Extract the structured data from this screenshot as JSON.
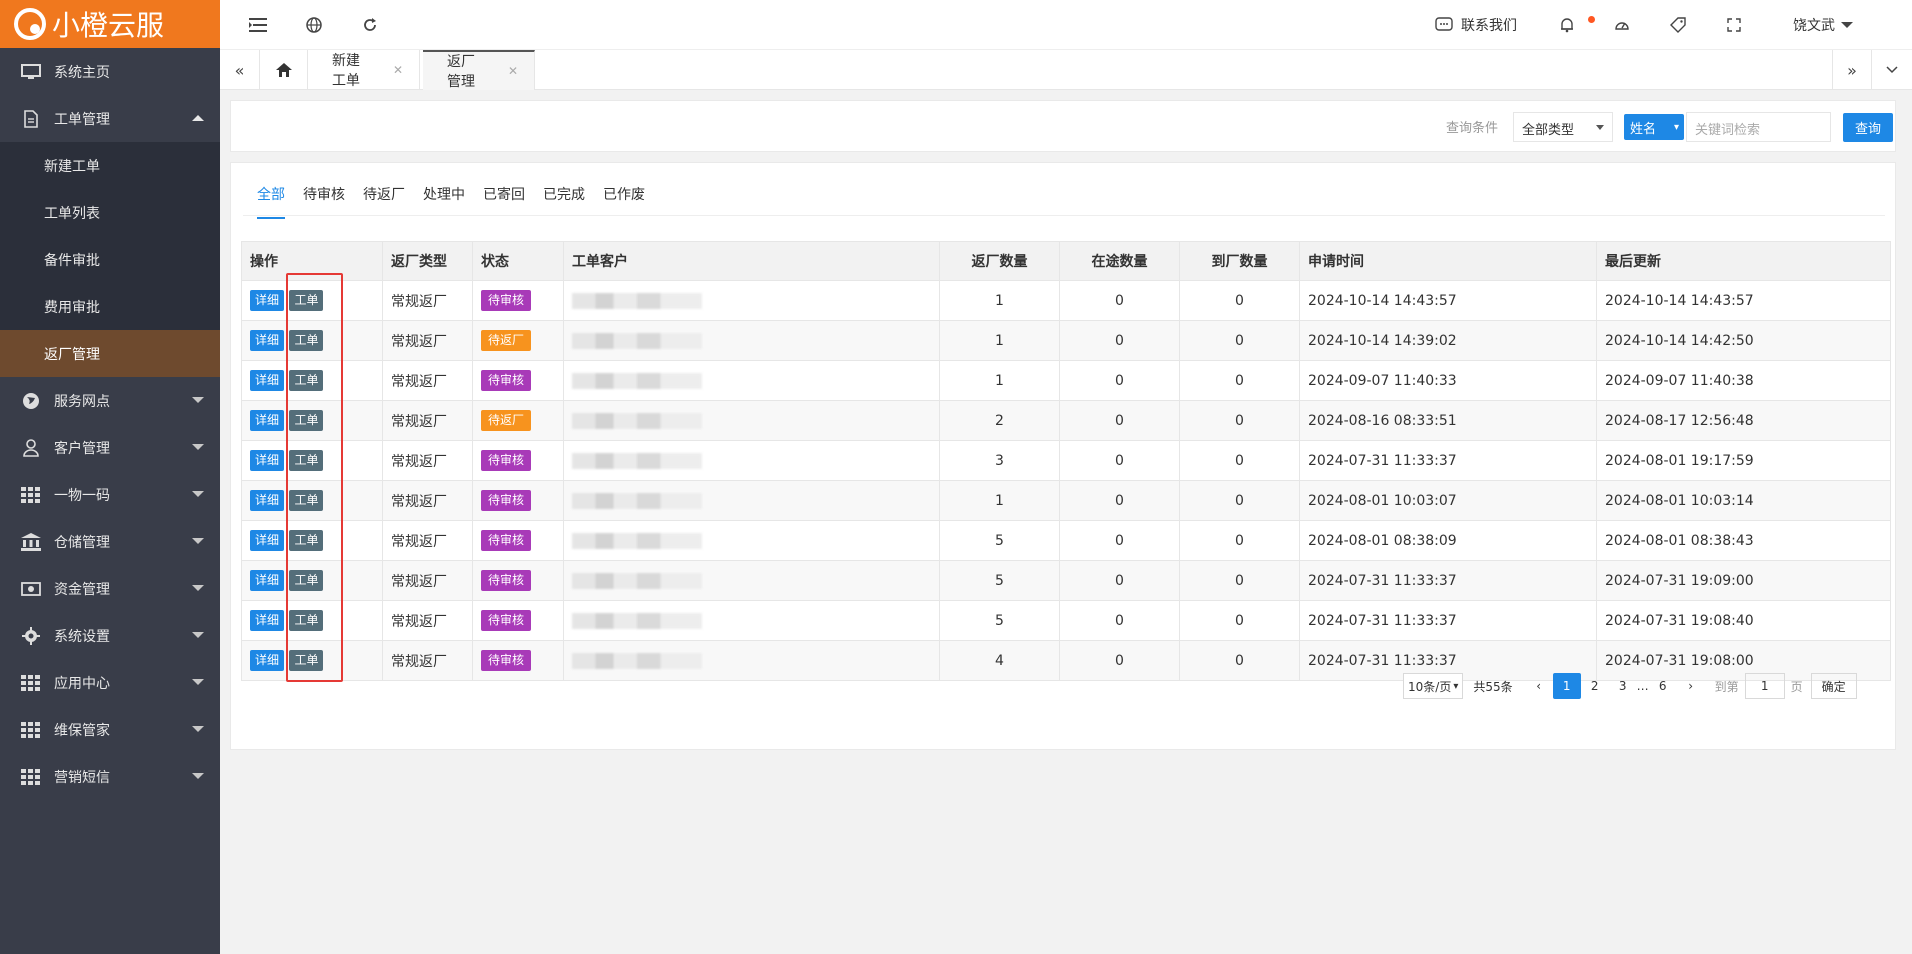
{
  "brand": {
    "name": "小橙云服"
  },
  "sidebar": {
    "items": [
      {
        "label": "系统主页",
        "icon": "monitor-icon"
      },
      {
        "label": "工单管理",
        "icon": "document-icon",
        "expanded": true,
        "children": [
          "新建工单",
          "工单列表",
          "备件审批",
          "费用审批",
          "返厂管理"
        ]
      },
      {
        "label": "服务网点",
        "icon": "globe-icon"
      },
      {
        "label": "客户管理",
        "icon": "user-icon"
      },
      {
        "label": "一物一码",
        "icon": "grid-icon"
      },
      {
        "label": "仓储管理",
        "icon": "bank-icon"
      },
      {
        "label": "资金管理",
        "icon": "money-icon"
      },
      {
        "label": "系统设置",
        "icon": "gear-icon"
      },
      {
        "label": "应用中心",
        "icon": "grid-icon"
      },
      {
        "label": "维保管家",
        "icon": "grid-icon"
      },
      {
        "label": "营销短信",
        "icon": "grid-icon"
      }
    ],
    "active_child": "返厂管理"
  },
  "topbar": {
    "contact_label": "联系我们",
    "user_name": "饶文武"
  },
  "tabs": {
    "items": [
      "新建工单",
      "返厂管理"
    ],
    "active": "返厂管理"
  },
  "search": {
    "condition_label": "查询条件",
    "type_select": "全部类型",
    "field_select": "姓名",
    "keyword_placeholder": "关键词检索",
    "query_button": "查询"
  },
  "filter_tabs": {
    "items": [
      "全部",
      "待审核",
      "待返厂",
      "处理中",
      "已寄回",
      "已完成",
      "已作废"
    ],
    "active": "全部"
  },
  "table": {
    "columns": [
      "操作",
      "返厂类型",
      "状态",
      "工单客户",
      "返厂数量",
      "在途数量",
      "到厂数量",
      "申请时间",
      "最后更新"
    ],
    "action_labels": {
      "detail": "详细",
      "work": "工单"
    },
    "status_colors": {
      "待审核": "#a83ab8",
      "待返厂": "#f7931e"
    },
    "rows": [
      {
        "type": "常规返厂",
        "status": "待审核",
        "qty": "1",
        "transit": "0",
        "arrived": "0",
        "applied": "2024-10-14 14:43:57",
        "updated": "2024-10-14 14:43:57"
      },
      {
        "type": "常规返厂",
        "status": "待返厂",
        "qty": "1",
        "transit": "0",
        "arrived": "0",
        "applied": "2024-10-14 14:39:02",
        "updated": "2024-10-14 14:42:50"
      },
      {
        "type": "常规返厂",
        "status": "待审核",
        "qty": "1",
        "transit": "0",
        "arrived": "0",
        "applied": "2024-09-07 11:40:33",
        "updated": "2024-09-07 11:40:38"
      },
      {
        "type": "常规返厂",
        "status": "待返厂",
        "qty": "2",
        "transit": "0",
        "arrived": "0",
        "applied": "2024-08-16 08:33:51",
        "updated": "2024-08-17 12:56:48"
      },
      {
        "type": "常规返厂",
        "status": "待审核",
        "qty": "3",
        "transit": "0",
        "arrived": "0",
        "applied": "2024-07-31 11:33:37",
        "updated": "2024-08-01 19:17:59"
      },
      {
        "type": "常规返厂",
        "status": "待审核",
        "qty": "1",
        "transit": "0",
        "arrived": "0",
        "applied": "2024-08-01 10:03:07",
        "updated": "2024-08-01 10:03:14"
      },
      {
        "type": "常规返厂",
        "status": "待审核",
        "qty": "5",
        "transit": "0",
        "arrived": "0",
        "applied": "2024-08-01 08:38:09",
        "updated": "2024-08-01 08:38:43"
      },
      {
        "type": "常规返厂",
        "status": "待审核",
        "qty": "5",
        "transit": "0",
        "arrived": "0",
        "applied": "2024-07-31 11:33:37",
        "updated": "2024-07-31 19:09:00"
      },
      {
        "type": "常规返厂",
        "status": "待审核",
        "qty": "5",
        "transit": "0",
        "arrived": "0",
        "applied": "2024-07-31 11:33:37",
        "updated": "2024-07-31 19:08:40"
      },
      {
        "type": "常规返厂",
        "status": "待审核",
        "qty": "4",
        "transit": "0",
        "arrived": "0",
        "applied": "2024-07-31 11:33:37",
        "updated": "2024-07-31 19:08:00"
      }
    ]
  },
  "pagination": {
    "page_size": "10条/页",
    "total": "共55条",
    "pages": [
      "1",
      "2",
      "3",
      "…",
      "6"
    ],
    "current": "1",
    "goto_label": "到第",
    "goto_value": "1",
    "page_unit": "页",
    "confirm": "确定"
  },
  "colors": {
    "accent": "#1e88e5",
    "brand": "#f0781e",
    "sidebar_bg": "#393d49",
    "highlight_box": "#e53935"
  }
}
